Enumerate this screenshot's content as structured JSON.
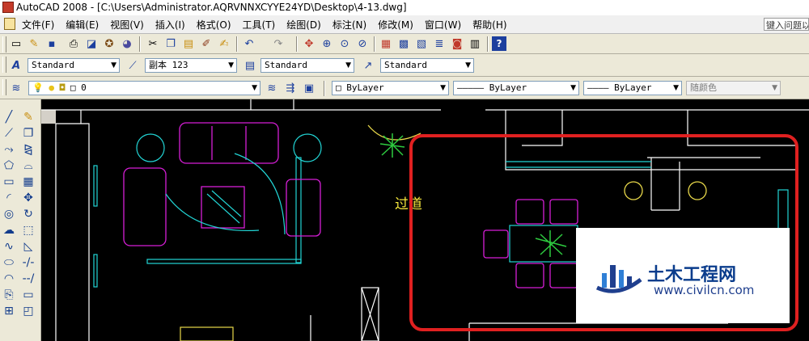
{
  "window": {
    "title": "AutoCAD 2008 - [C:\\Users\\Administrator.AQRVNNXCYYE24YD\\Desktop\\4-13.dwg]"
  },
  "menu": {
    "items": [
      "文件(F)",
      "编辑(E)",
      "视图(V)",
      "插入(I)",
      "格式(O)",
      "工具(T)",
      "绘图(D)",
      "标注(N)",
      "修改(M)",
      "窗口(W)",
      "帮助(H)"
    ],
    "help_placeholder": "键入问题以"
  },
  "styles_toolbar": {
    "text_style": "Standard",
    "dim_style": "副本 123",
    "table_style": "Standard",
    "multileader_style": "Standard"
  },
  "layers_toolbar": {
    "layer": "0",
    "color": "ByLayer",
    "linetype": "ByLayer",
    "lineweight": "ByLayer",
    "plotstyle": "随颜色"
  },
  "drawing": {
    "room_label": "过道",
    "highlight_color": "#e02020"
  },
  "watermark": {
    "name": "土木工程网",
    "url": "www.civilcn.com"
  },
  "icons": {
    "standard": [
      "new-icon",
      "open-icon",
      "save-icon",
      "plot-icon",
      "plot-preview-icon",
      "publish-icon",
      "3d-dwf-icon",
      "cut-icon",
      "copy-icon",
      "paste-icon",
      "match-properties-icon",
      "block-editor-icon",
      "undo-icon",
      "redo-icon",
      "pan-icon",
      "zoom-realtime-icon",
      "zoom-window-icon",
      "zoom-previous-icon",
      "properties-icon",
      "design-center-icon",
      "tool-palettes-icon",
      "sheet-set-icon",
      "markup-icon",
      "quickcalc-icon",
      "help-icon"
    ],
    "draw": [
      "line-icon",
      "construction-line-icon",
      "polyline-icon",
      "polygon-icon",
      "rectangle-icon",
      "arc-icon",
      "circle-icon",
      "revision-cloud-icon",
      "spline-icon",
      "ellipse-icon",
      "ellipse-arc-icon",
      "insert-block-icon",
      "make-block-icon"
    ],
    "modify": [
      "erase-icon",
      "copy-object-icon",
      "mirror-icon",
      "offset-icon",
      "array-icon",
      "move-icon",
      "rotate-icon",
      "scale-icon",
      "stretch-icon",
      "trim-icon",
      "extend-icon",
      "break-icon",
      "chamfer-icon"
    ]
  }
}
